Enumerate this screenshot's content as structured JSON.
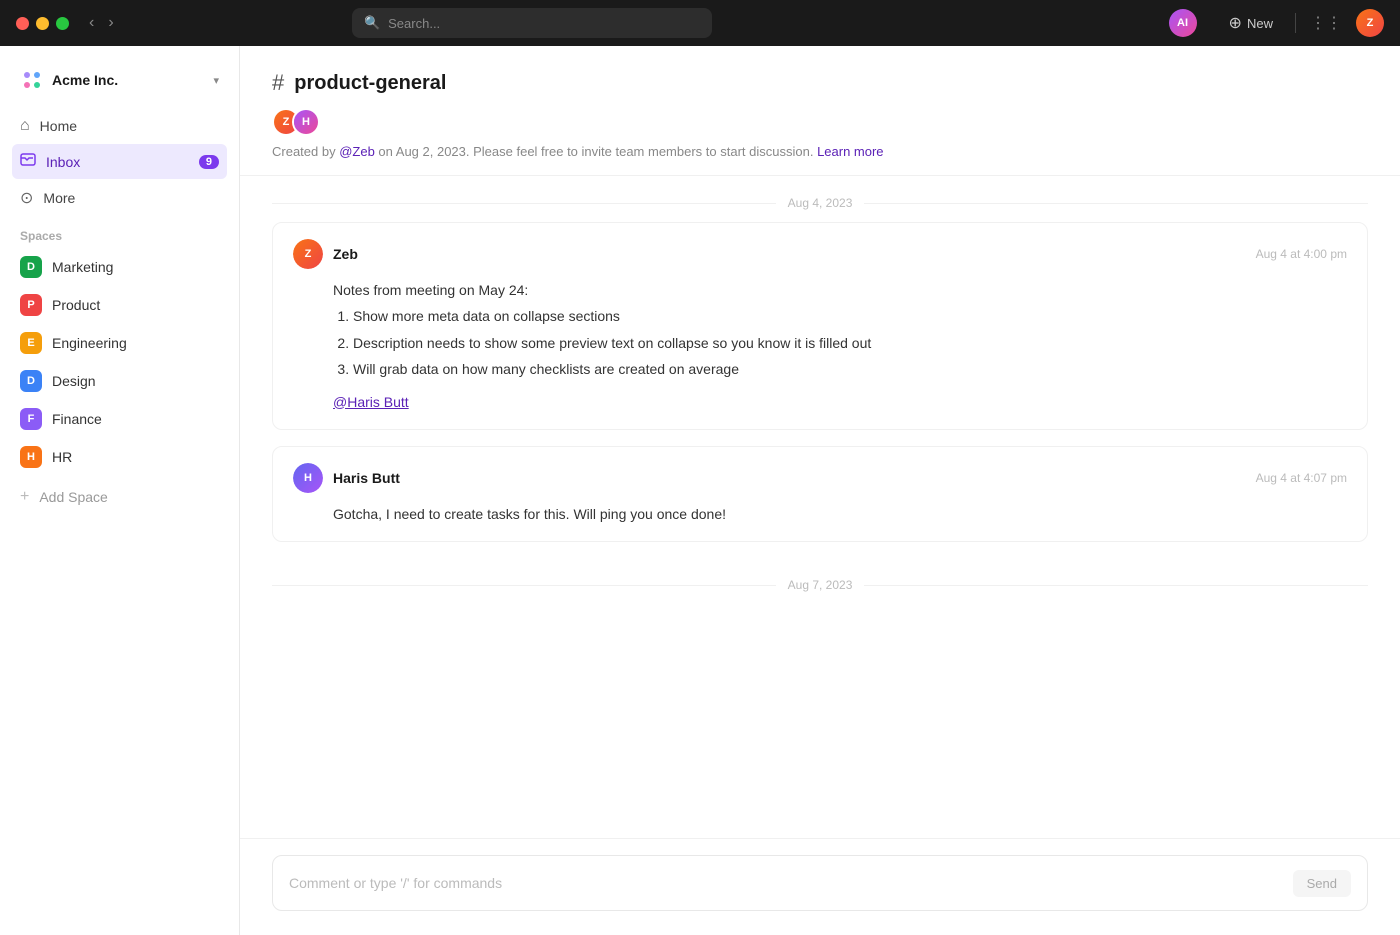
{
  "topbar": {
    "search_placeholder": "Search...",
    "ai_label": "AI",
    "new_label": "New"
  },
  "workspace": {
    "name": "Acme Inc.",
    "caret": "▾"
  },
  "nav": {
    "items": [
      {
        "id": "home",
        "label": "Home",
        "icon": "🏠",
        "active": false
      },
      {
        "id": "inbox",
        "label": "Inbox",
        "icon": "📥",
        "active": true,
        "badge": "9"
      },
      {
        "id": "more",
        "label": "More",
        "icon": "⊙",
        "active": false
      }
    ]
  },
  "spaces": {
    "section_label": "Spaces",
    "items": [
      {
        "id": "marketing",
        "label": "Marketing",
        "letter": "D",
        "color": "#16a34a"
      },
      {
        "id": "product",
        "label": "Product",
        "letter": "P",
        "color": "#ef4444"
      },
      {
        "id": "engineering",
        "label": "Engineering",
        "letter": "E",
        "color": "#f59e0b"
      },
      {
        "id": "design",
        "label": "Design",
        "letter": "D",
        "color": "#3b82f6"
      },
      {
        "id": "finance",
        "label": "Finance",
        "letter": "F",
        "color": "#8b5cf6"
      },
      {
        "id": "hr",
        "label": "HR",
        "letter": "H",
        "color": "#f97316"
      }
    ],
    "add_label": "Add Space"
  },
  "channel": {
    "hash": "#",
    "name": "product-general",
    "meta_prefix": "Created by ",
    "meta_author": "@Zeb",
    "meta_suffix": " on Aug 2, 2023. Please feel free to invite team members to start discussion. ",
    "meta_link": "Learn more"
  },
  "dates": [
    {
      "label": "Aug 4, 2023"
    },
    {
      "label": "Aug 7, 2023"
    }
  ],
  "messages": [
    {
      "id": "msg1",
      "author": "Zeb",
      "avatar_color": "#f97316",
      "avatar_letter": "Z",
      "time": "Aug 4 at 4:00 pm",
      "body_intro": "Notes from meeting on May 24:",
      "list": [
        "Show more meta data on collapse sections",
        "Description needs to show some preview text on collapse so you know it is filled out",
        "Will grab data on how many checklists are created on average"
      ],
      "mention": "@Haris Butt"
    },
    {
      "id": "msg2",
      "author": "Haris Butt",
      "avatar_color": "#6366f1",
      "avatar_letter": "H",
      "time": "Aug 4 at 4:07 pm",
      "body": "Gotcha, I need to create tasks for this. Will ping you once done!",
      "list": null,
      "mention": null
    }
  ],
  "comment": {
    "placeholder": "Comment or type '/' for commands",
    "send_label": "Send"
  },
  "members": [
    {
      "id": "m1",
      "color1": "#f97316",
      "color2": "#ef4444",
      "letter": "Z"
    },
    {
      "id": "m2",
      "color1": "#a855f7",
      "color2": "#ec4899",
      "letter": "H"
    }
  ]
}
